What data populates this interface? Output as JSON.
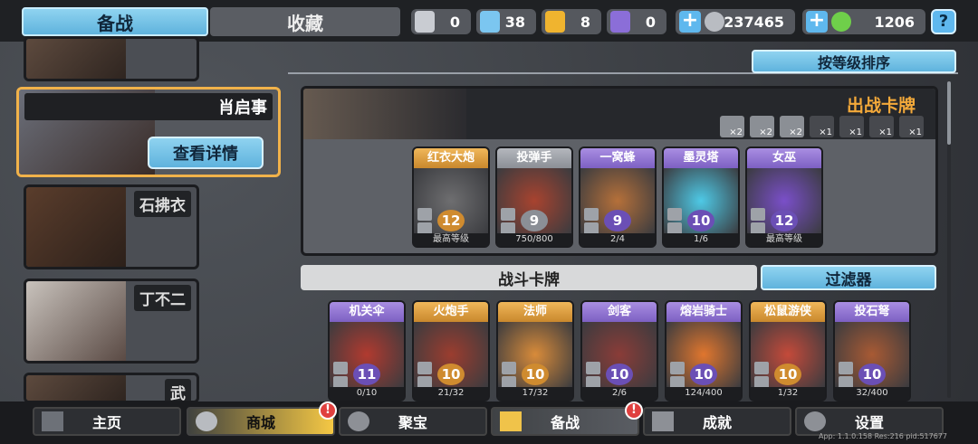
{
  "tabs": {
    "prepare": "备战",
    "collection": "收藏"
  },
  "resources": [
    {
      "name": "silver-shield",
      "value": "0",
      "color": "#c9ccd2"
    },
    {
      "name": "blue-crystal",
      "value": "38",
      "color": "#7bc6f0"
    },
    {
      "name": "gold-shield",
      "value": "8",
      "color": "#f0b42f"
    },
    {
      "name": "purple-shield",
      "value": "0",
      "color": "#8b6ed8"
    },
    {
      "name": "coins",
      "value": "237465",
      "color": "#b9bcc2"
    },
    {
      "name": "gems",
      "value": "1206",
      "color": "#6fcf4a"
    }
  ],
  "help_label": "?",
  "heroes": [
    {
      "name": ""
    },
    {
      "name": "肖启事"
    },
    {
      "name": "石拂衣"
    },
    {
      "name": "丁不二"
    },
    {
      "name": "武"
    }
  ],
  "detail_button": "查看详情",
  "sort_button": "按等级排序",
  "deck": {
    "title": "出战卡牌",
    "slots": [
      "×2",
      "×2",
      "×2",
      "×1",
      "×1",
      "×1",
      "×1"
    ],
    "cards": [
      {
        "name": "红衣大炮",
        "level": "12",
        "footer": "最高等级",
        "rarity": "gold"
      },
      {
        "name": "投弹手",
        "level": "9",
        "footer": "750/800",
        "rarity": "gray"
      },
      {
        "name": "一窝蜂",
        "level": "9",
        "footer": "2/4",
        "rarity": "purple"
      },
      {
        "name": "墨灵塔",
        "level": "10",
        "footer": "1/6",
        "rarity": "purple"
      },
      {
        "name": "女巫",
        "level": "12",
        "footer": "最高等级",
        "rarity": "purple"
      }
    ]
  },
  "battle_cards_title": "战斗卡牌",
  "filter_button": "过滤器",
  "battle_cards": [
    {
      "name": "机关伞",
      "level": "11",
      "footer": "0/10",
      "rarity": "purple"
    },
    {
      "name": "火炮手",
      "level": "10",
      "footer": "21/32",
      "rarity": "gold"
    },
    {
      "name": "法师",
      "level": "10",
      "footer": "17/32",
      "rarity": "gold"
    },
    {
      "name": "剑客",
      "level": "10",
      "footer": "2/6",
      "rarity": "purple"
    },
    {
      "name": "熔岩骑士",
      "level": "10",
      "footer": "124/400",
      "rarity": "purple"
    },
    {
      "name": "松鼠游侠",
      "level": "10",
      "footer": "1/32",
      "rarity": "gold"
    },
    {
      "name": "投石弩",
      "level": "10",
      "footer": "32/400",
      "rarity": "purple"
    }
  ],
  "nav": {
    "home": "主页",
    "shop": "商城",
    "treasure": "聚宝",
    "prepare": "备战",
    "achievement": "成就",
    "settings": "设置",
    "badge": "!"
  },
  "version": "App: 1.1.0.158 Res:216 pid:517677"
}
